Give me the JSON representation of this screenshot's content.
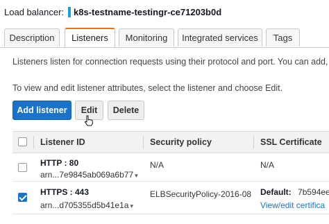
{
  "header": {
    "label": "Load balancer:",
    "name": "k8s-testname-testingr-ce71203b0d"
  },
  "tabs": [
    {
      "label": "Description",
      "active": false
    },
    {
      "label": "Listeners",
      "active": true
    },
    {
      "label": "Monitoring",
      "active": false
    },
    {
      "label": "Integrated services",
      "active": false
    },
    {
      "label": "Tags",
      "active": false
    }
  ],
  "description": {
    "line1": "Listeners listen for connection requests using their protocol and port. You can add, rem",
    "line2": "To view and edit listener attributes, select the listener and choose Edit."
  },
  "toolbar": {
    "add_label": "Add listener",
    "edit_label": "Edit",
    "delete_label": "Delete"
  },
  "table": {
    "columns": [
      "Listener ID",
      "Security policy",
      "SSL Certificate"
    ],
    "rows": [
      {
        "selected": false,
        "listener": "HTTP : 80",
        "arn": "arn...7e9845ab069a6b77",
        "policy": "N/A",
        "cert_label": "N/A",
        "cert_value": "",
        "cert_link": ""
      },
      {
        "selected": true,
        "listener": "HTTPS : 443",
        "arn": "arn...d705355d5b41e1a",
        "policy": "ELBSecurityPolicy-2016-08",
        "cert_label": "Default:",
        "cert_value": "7b594ee",
        "cert_link": "View/edit certifica"
      }
    ]
  },
  "colors": {
    "accent": "#1a73c8",
    "tab_active": "#ec7211",
    "lb_swatch": "#1e9fcc"
  }
}
